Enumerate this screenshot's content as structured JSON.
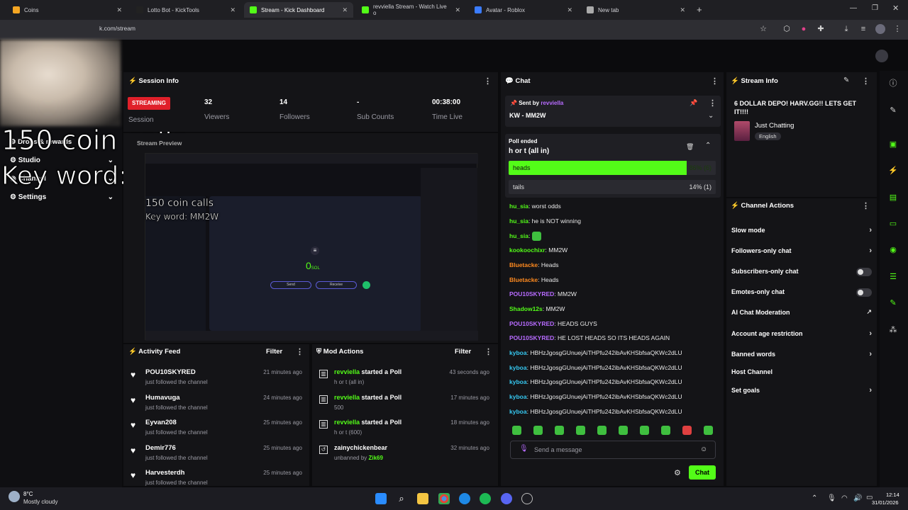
{
  "tabs": [
    {
      "label": "Coins",
      "icon": "coin-tab-icon",
      "color": "#f5a623"
    },
    {
      "label": "Lotto Bot - KickTools",
      "icon": "kicktools-favicon",
      "color": "#222"
    },
    {
      "label": "Stream - Kick Dashboard",
      "icon": "kick-favicon",
      "color": "#53fc18",
      "active": true
    },
    {
      "label": "revviella Stream - Watch Live o",
      "icon": "kick-favicon",
      "color": "#53fc18"
    },
    {
      "label": "Avatar - Roblox",
      "icon": "roblox-favicon",
      "color": "#3b7cff"
    },
    {
      "label": "New tab",
      "icon": "chrome-favicon",
      "color": "#aaa"
    }
  ],
  "address": {
    "url": "k.com/stream"
  },
  "overlay": {
    "line1": "150 coin calls",
    "line2": "Key word: MM2W"
  },
  "sidebar": {
    "items": [
      {
        "label": "Drops & rewards"
      },
      {
        "label": "Studio"
      },
      {
        "label": "Channel"
      },
      {
        "label": "Settings"
      }
    ]
  },
  "session": {
    "title": "Session Info",
    "status": "STREAMING",
    "status_label": "Session",
    "stats": [
      {
        "value": "32",
        "label": "Viewers"
      },
      {
        "value": "14",
        "label": "Followers"
      },
      {
        "value": "-",
        "label": "Sub Counts"
      },
      {
        "value": "00:38:00",
        "label": "Time Live"
      }
    ]
  },
  "preview": {
    "title": "Stream Preview",
    "line1": "150 coin calls",
    "line2": "Key word: MM2W",
    "sol_value": "0",
    "sol_unit": "SOL",
    "btn_send": "Send",
    "btn_receive": "Receive"
  },
  "chat": {
    "title": "Chat",
    "pinned": {
      "sent_by_label": "Sent by",
      "sender": "revviella",
      "message": "KW - MM2W"
    },
    "poll": {
      "status": "Poll ended",
      "question": "h or t (all in)",
      "options": [
        {
          "label": "heads",
          "result": "86% (6)",
          "pct": 0.86
        },
        {
          "label": "tails",
          "result": "14% (1)",
          "pct": 0.14
        }
      ]
    },
    "messages": [
      {
        "user": "hu_sia",
        "color": "#53fc18",
        "text": "worst odds"
      },
      {
        "user": "hu_sia",
        "color": "#53fc18",
        "text": "he is NOT winning"
      },
      {
        "user": "hu_sia",
        "color": "#53fc18",
        "text": "",
        "emote": true
      },
      {
        "user": "kookoochixr",
        "color": "#53fc18",
        "text": "MM2W"
      },
      {
        "user": "Bluetacke",
        "color": "#ff8a1f",
        "text": "Heads"
      },
      {
        "user": "Bluetacke",
        "color": "#ff8a1f",
        "text": "Heads"
      },
      {
        "user": "POU10SKYRED",
        "color": "#b76bff",
        "text": "MM2W"
      },
      {
        "user": "Shadow12s",
        "color": "#53fc18",
        "text": "MM2W"
      },
      {
        "user": "POU10SKYRED",
        "color": "#b76bff",
        "text": "HEADS GUYS"
      },
      {
        "user": "POU10SKYRED",
        "color": "#b76bff",
        "text": "HE LOST HEADS SO ITS HEADS AGAIN"
      },
      {
        "user": "kyboa",
        "color": "#35c7f0",
        "text": "HBHzJgosgGUnuejAiTHPfu242ibAvKHSbfsaQKWc2dLU"
      },
      {
        "user": "kyboa",
        "color": "#35c7f0",
        "text": "HBHzJgosgGUnuejAiTHPfu242ibAvKHSbfsaQKWc2dLU"
      },
      {
        "user": "kyboa",
        "color": "#35c7f0",
        "text": "HBHzJgosgGUnuejAiTHPfu242ibAvKHSbfsaQKWc2dLU"
      },
      {
        "user": "kyboa",
        "color": "#35c7f0",
        "text": "HBHzJgosgGUnuejAiTHPfu242ibAvKHSbfsaQKWc2dLU"
      },
      {
        "user": "kyboa",
        "color": "#35c7f0",
        "text": "HBHzJgosgGUnuejAiTHPfu242ibAvKHSbfsaQKWc2dLU"
      }
    ],
    "input_placeholder": "Send a message",
    "send_label": "Chat"
  },
  "activity": {
    "title": "Activity Feed",
    "filter": "Filter",
    "items": [
      {
        "name": "POU10SKYRED",
        "desc": "just followed the channel",
        "time": "21 minutes ago"
      },
      {
        "name": "Humavuga",
        "desc": "just followed the channel",
        "time": "24 minutes ago"
      },
      {
        "name": "Eyvan208",
        "desc": "just followed the channel",
        "time": "25 minutes ago"
      },
      {
        "name": "Demir776",
        "desc": "just followed the channel",
        "time": "25 minutes ago"
      },
      {
        "name": "Harvesterdh",
        "desc": "just followed the channel",
        "time": "25 minutes ago"
      }
    ]
  },
  "mod": {
    "title": "Mod Actions",
    "filter": "Filter",
    "items": [
      {
        "user": "revviella",
        "action": "started a Poll",
        "detail": "h or t (all in)",
        "time": "43 seconds ago"
      },
      {
        "user": "revviella",
        "action": "started a Poll",
        "detail": "500",
        "time": "17 minutes ago"
      },
      {
        "user": "revviella",
        "action": "started a Poll",
        "detail": "h or t (600)",
        "time": "18 minutes ago"
      },
      {
        "user": "zainychickenbear",
        "action": "",
        "detail": "unbanned by",
        "by": "Zik69",
        "time": "32 minutes ago"
      }
    ]
  },
  "stream_info": {
    "title": "Stream Info",
    "stream_title": "6 DOLLAR DEPO! HARV.GG!! LETS GET IT!!!!",
    "category": "Just Chatting",
    "language": "English"
  },
  "channel_actions": {
    "title": "Channel Actions",
    "items": [
      {
        "label": "Slow mode",
        "control": "chevron"
      },
      {
        "label": "Followers-only chat",
        "control": "chevron"
      },
      {
        "label": "Subscribers-only chat",
        "control": "toggle"
      },
      {
        "label": "Emotes-only chat",
        "control": "toggle"
      },
      {
        "label": "AI Chat Moderation",
        "control": "external"
      },
      {
        "label": "Account age restriction",
        "control": "chevron"
      },
      {
        "label": "Banned words",
        "control": "chevron"
      },
      {
        "label": "Host Channel",
        "control": "none"
      },
      {
        "label": "Set goals",
        "control": "chevron"
      }
    ]
  },
  "taskbar": {
    "weather_temp": "8°C",
    "weather_desc": "Mostly cloudy",
    "time": "12:14",
    "date": "31/01/2026"
  }
}
